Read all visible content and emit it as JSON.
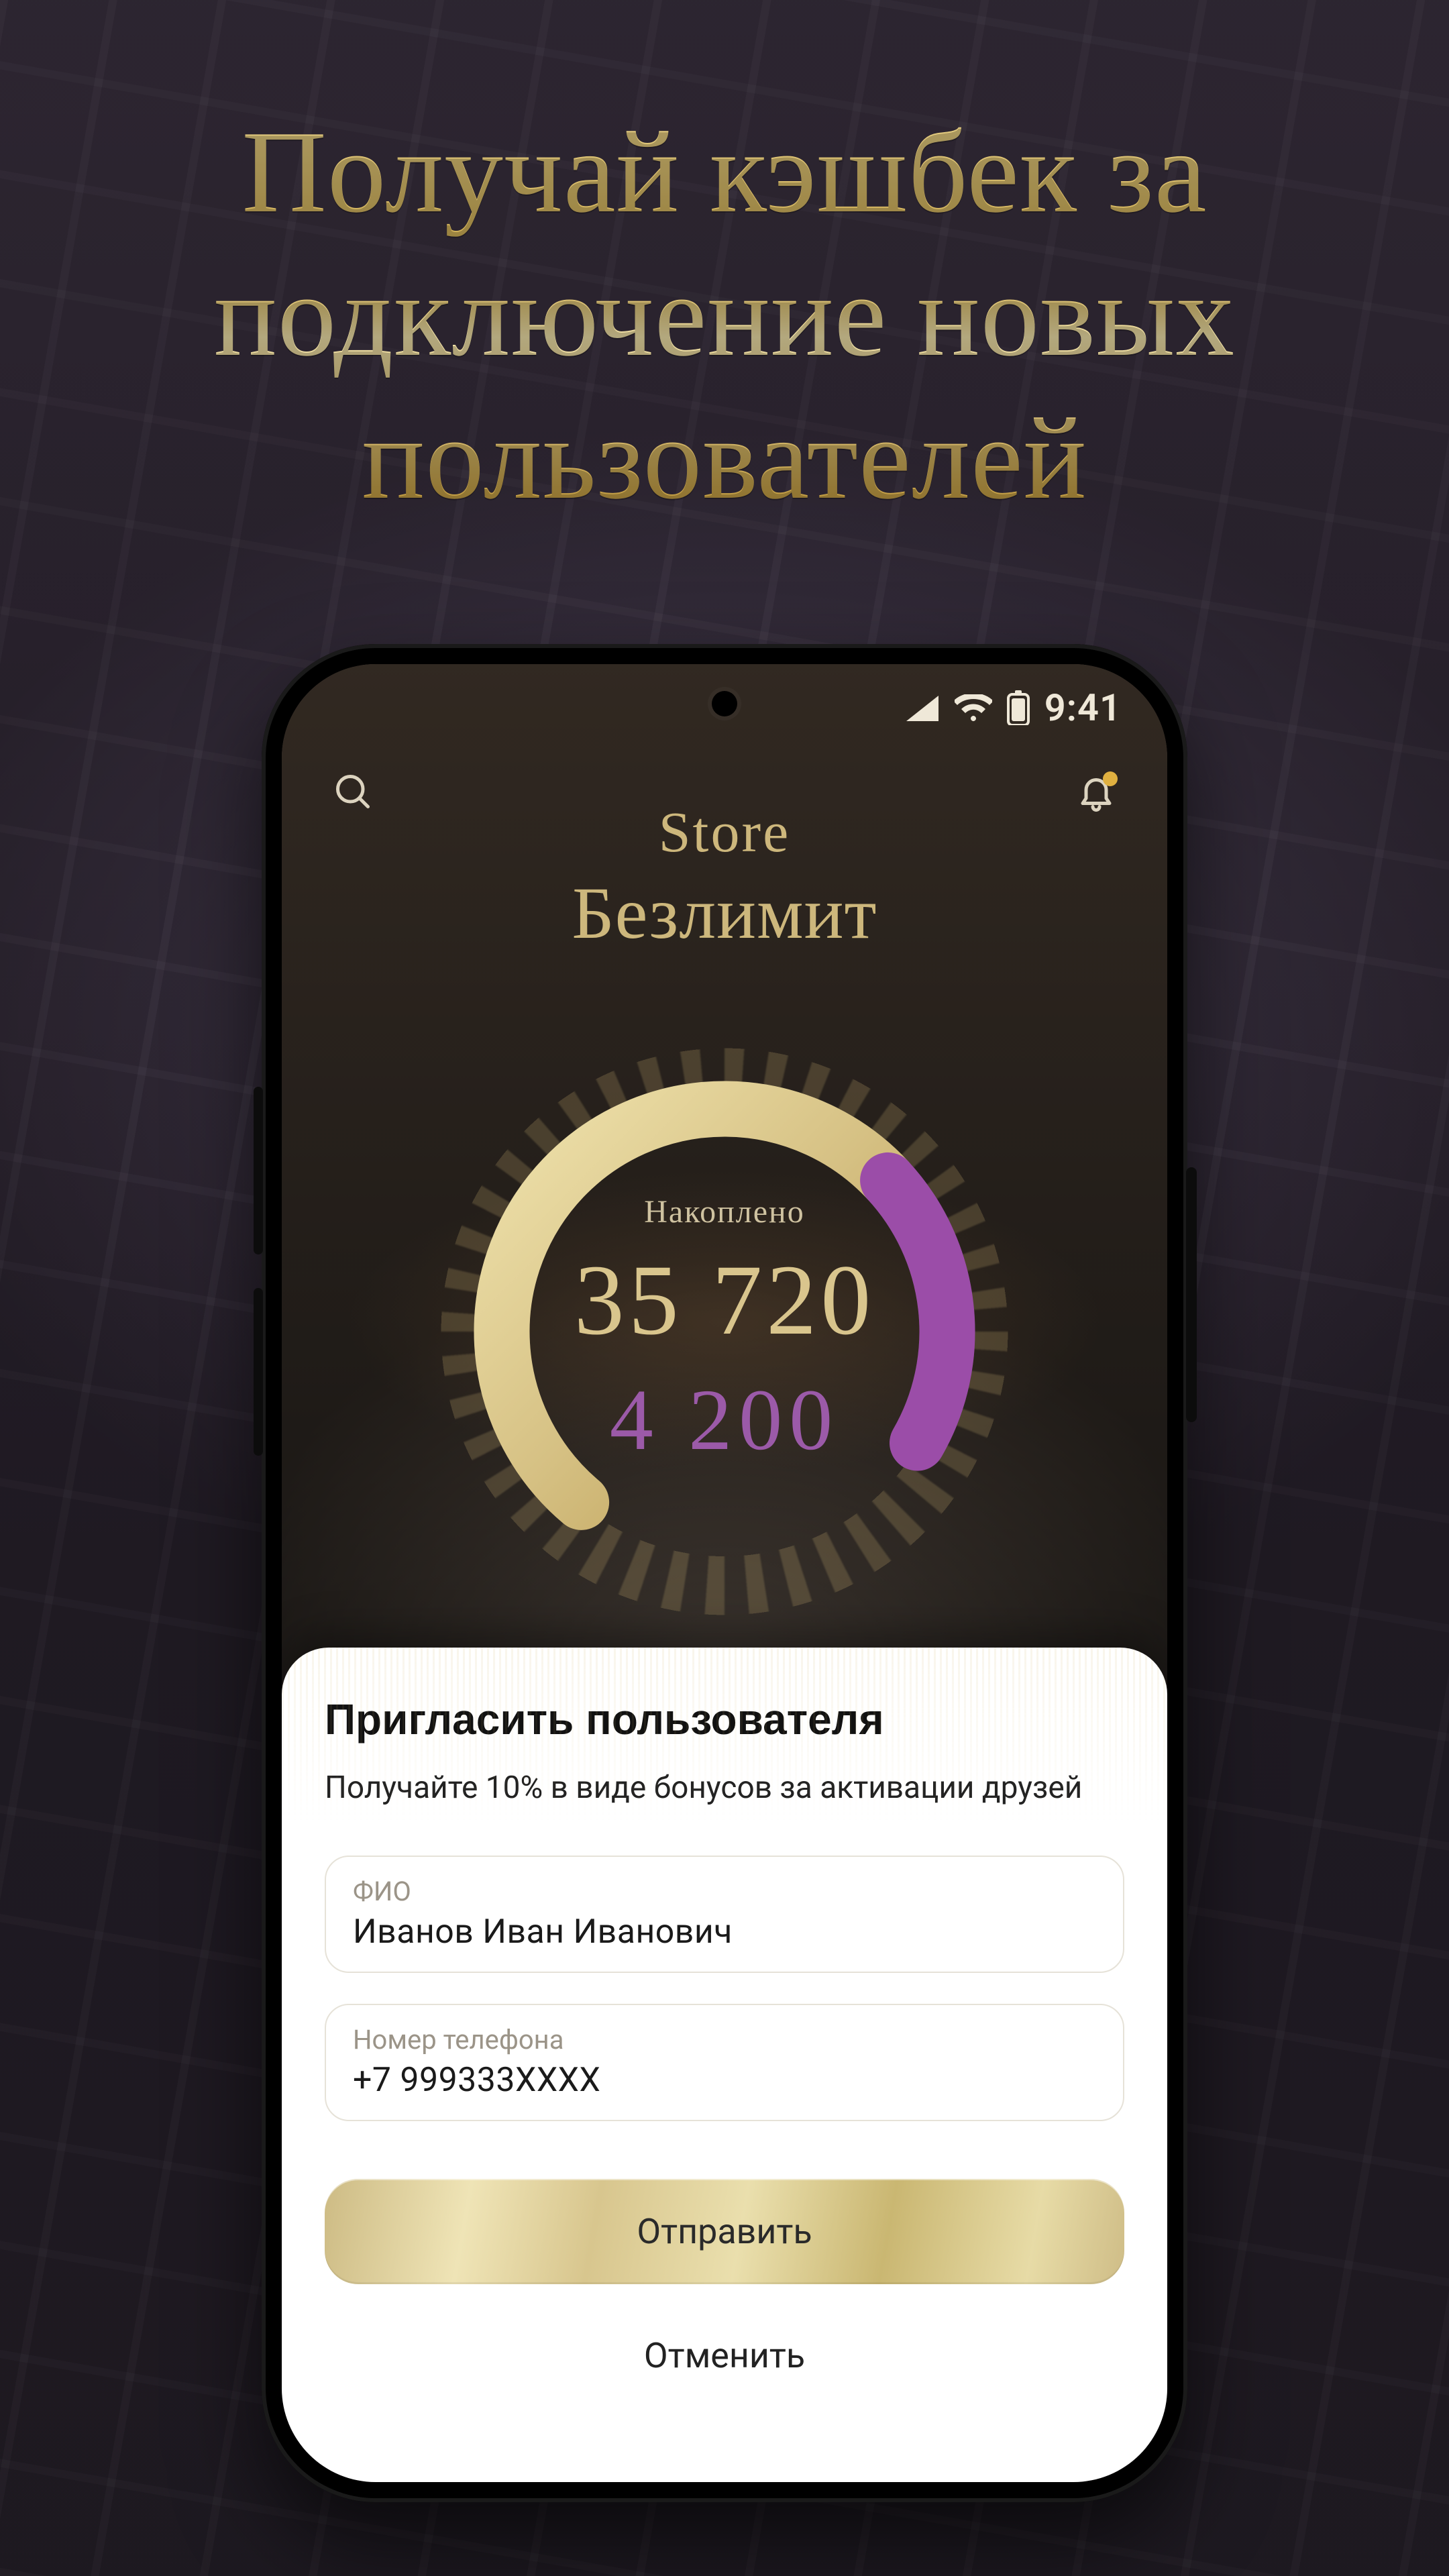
{
  "headline": "Получай кэшбек за подключение новых пользователей",
  "status": {
    "time": "9:41"
  },
  "brand": {
    "line1": "Store",
    "line2": "Безлимит"
  },
  "gauge": {
    "label": "Накоплено",
    "main_value": "35 720",
    "sub_value": "4 200",
    "progress_pct": 72
  },
  "sheet": {
    "title": "Пригласить пользователя",
    "desc": "Получайте 10% в виде бонусов за активации друзей",
    "name_label": "ФИО",
    "name_value": "Иванов Иван Иванович",
    "phone_label": "Номер телефона",
    "phone_value": "+7 999333XXXX",
    "submit": "Отправить",
    "cancel": "Отменить"
  },
  "colors": {
    "gold": "#d8c48a",
    "gold_dim": "#8f7a42",
    "purple": "#9b4da8"
  }
}
